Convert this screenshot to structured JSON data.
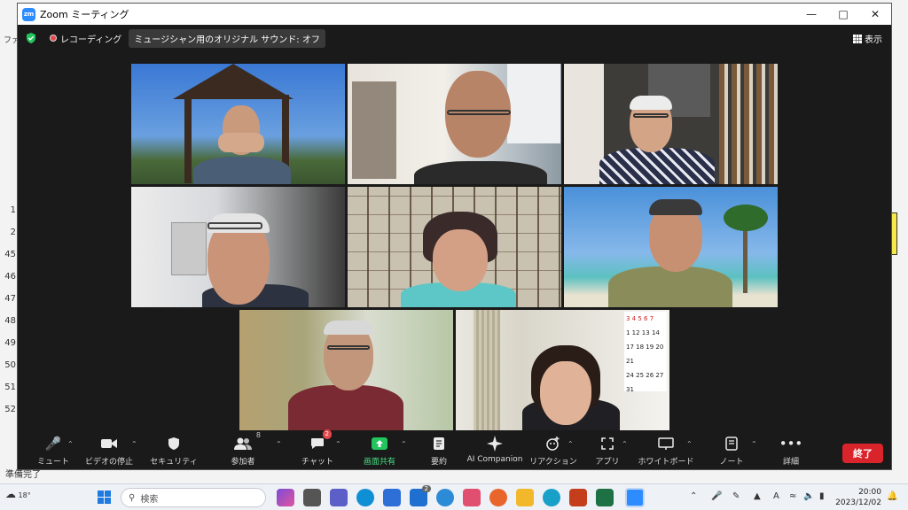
{
  "window": {
    "title": "Zoom ミーティング",
    "app_icon_text": "zm"
  },
  "topbar": {
    "recording_label": "レコーディング",
    "music_mode_label": "ミュージシャン用のオリジナル サウンド: オフ",
    "view_label": "表示"
  },
  "toolbar": {
    "mute": "ミュート",
    "video": "ビデオの停止",
    "security": "セキュリティ",
    "participants": "参加者",
    "participants_count": "8",
    "chat": "チャット",
    "chat_badge": "2",
    "share": "画面共有",
    "summary": "要約",
    "ai_companion": "AI Companion",
    "reactions": "リアクション",
    "apps": "アプリ",
    "whiteboard": "ホワイトボード",
    "notes": "ノート",
    "more": "詳細",
    "end": "終了"
  },
  "background_app": {
    "row_numbers": [
      "1",
      "2",
      "45",
      "46",
      "47",
      "48",
      "49",
      "50",
      "51",
      "52"
    ],
    "left_tab": "ファ",
    "status_text": "準備完了"
  },
  "calendar": {
    "rows": [
      "3 4 5 6 7",
      "1 12 13 14",
      "17 18 19 20 21",
      "24 25 26 27",
      "31"
    ]
  },
  "taskbar": {
    "temperature": "18°",
    "search_placeholder": "検索",
    "time": "20:00",
    "date": "2023/12/02",
    "mail_badge": "2"
  },
  "colors": {
    "active_speaker": "#e6e600",
    "end_button": "#d9242b",
    "share_green": "#22c55e"
  }
}
